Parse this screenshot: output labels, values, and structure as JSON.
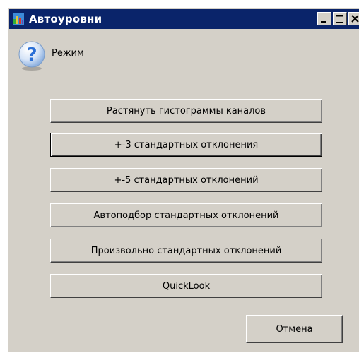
{
  "window": {
    "title": "Автоуровни",
    "icon": "levels-app-icon",
    "controls": [
      "minimize",
      "maximize",
      "close"
    ]
  },
  "header": {
    "icon": "question-icon",
    "label": "Режим"
  },
  "options": [
    {
      "label": "Растянуть гистограммы каналов"
    },
    {
      "label": "+-3 стандартных отклонения",
      "focused": true
    },
    {
      "label": "+-5 стандартных отклонений"
    },
    {
      "label": "Автоподбор стандартных отклонений"
    },
    {
      "label": "Произвольно стандартных отклонений"
    },
    {
      "label": "QuickLook"
    }
  ],
  "cancel_label": "Отмена",
  "colors": {
    "titlebar": "#0a246a",
    "dialog_bg": "#d4d0c8",
    "question_icon": "#2a6fd6"
  }
}
